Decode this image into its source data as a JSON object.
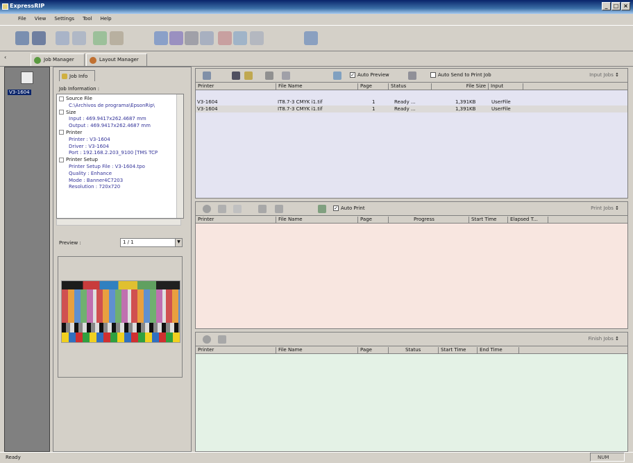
{
  "window": {
    "title": "ExpressRIP"
  },
  "menu": [
    "File",
    "View",
    "Settings",
    "Tool",
    "Help"
  ],
  "tabs": [
    {
      "label": "Job Manager"
    },
    {
      "label": "Layout Manager"
    }
  ],
  "printer_list": {
    "selected": "V3-1604"
  },
  "job_info": {
    "tab_label": "Job Info",
    "heading": "Job Information :",
    "tree": [
      {
        "type": "cat",
        "text": "Source File"
      },
      {
        "type": "val",
        "text": "C:\\Archivos de programa\\EpsonRip\\"
      },
      {
        "type": "cat",
        "text": "Size"
      },
      {
        "type": "val",
        "text": "Input : 469.9417x262.4687 mm"
      },
      {
        "type": "val",
        "text": "Output : 469.9417x262.4687 mm"
      },
      {
        "type": "cat",
        "text": "Printer"
      },
      {
        "type": "val",
        "text": "Printer : V3-1604"
      },
      {
        "type": "val",
        "text": "Driver : V3-1604"
      },
      {
        "type": "val",
        "text": "Port : 192.168.2.203_9100 [TMS TCP"
      },
      {
        "type": "cat",
        "text": "Printer Setup"
      },
      {
        "type": "val",
        "text": "Printer Setup File : V3-1604.tpo"
      },
      {
        "type": "val",
        "text": "Quality : Enhance"
      },
      {
        "type": "val",
        "text": "Mode : Banner4C7203"
      },
      {
        "type": "val",
        "text": "Resolution : 720x720"
      }
    ],
    "preview_label": "Preview :",
    "preview_value": "1 / 1"
  },
  "input_pane": {
    "auto_preview_label": "Auto Preview",
    "auto_send_label": "Auto Send to Print Job",
    "side_label": "Input Jobs",
    "columns": [
      "Printer",
      "File Name",
      "Page",
      "Status",
      "File Size",
      "Input"
    ],
    "rows": [
      {
        "printer": "V3-1604",
        "file": "IT8.7-3 CMYK i1.tif",
        "page": "1",
        "status": "Ready ...",
        "size": "1,391KB",
        "input": "UserFile"
      },
      {
        "printer": "V3-1604",
        "file": "IT8.7-3 CMYK i1.tif",
        "page": "1",
        "status": "Ready ...",
        "size": "1,391KB",
        "input": "UserFile"
      }
    ]
  },
  "print_pane": {
    "auto_print_label": "Auto Print",
    "side_label": "Print Jobs",
    "columns": [
      "Printer",
      "File Name",
      "Page",
      "Progress",
      "Start Time",
      "Elapsed T..."
    ]
  },
  "finish_pane": {
    "side_label": "Finish Jobs",
    "columns": [
      "Printer",
      "File Name",
      "Page",
      "Status",
      "Start Time",
      "End Time"
    ]
  },
  "statusbar": {
    "text": "Ready",
    "num": "NUM"
  },
  "colors": {
    "input_bg": "#e4e4f2",
    "print_bg": "#f8e6e0",
    "finish_bg": "#e4f2e6",
    "selection": "#0a246a"
  }
}
